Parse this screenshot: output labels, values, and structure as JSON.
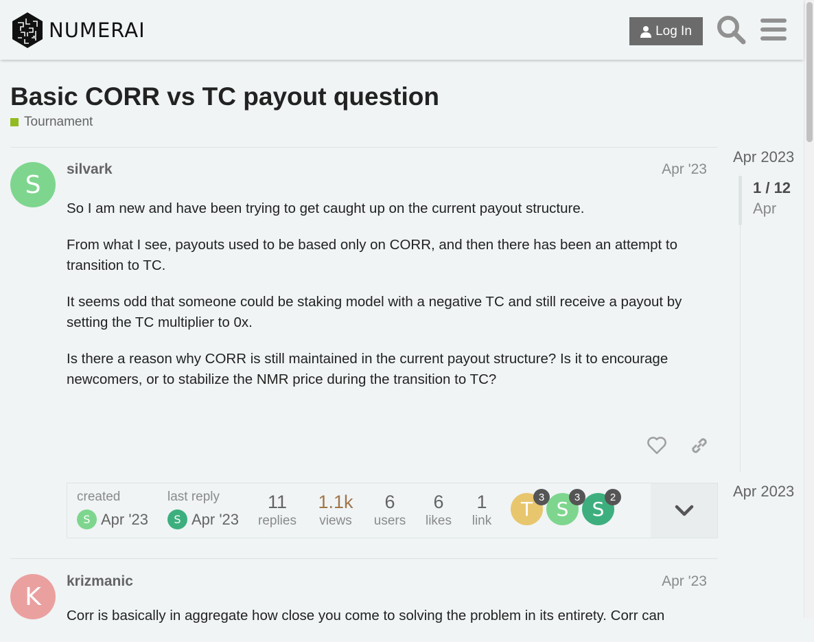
{
  "header": {
    "logo_text": "NUMERAI",
    "login_label": "Log In"
  },
  "topic": {
    "title": "Basic CORR vs TC payout question",
    "category": "Tournament",
    "category_color": "#92ba21"
  },
  "posts": [
    {
      "username": "silvark",
      "avatar_letter": "S",
      "avatar_color": "#7ed68e",
      "date": "Apr '23",
      "paragraphs": [
        "So I am new and have been trying to get caught up on the current payout structure.",
        "From what I see, payouts used to be based only on CORR, and then there has been an attempt to transition to TC.",
        "It seems odd that someone could be staking model with a negative TC and still receive a payout by setting the TC multiplier to 0x.",
        "Is there a reason why CORR is still maintained in the current payout structure? Is it to encourage newcomers, or to stabilize the NMR price during the transition to TC?"
      ]
    },
    {
      "username": "krizmanic",
      "avatar_letter": "K",
      "avatar_color": "#eba0a0",
      "date": "Apr '23",
      "paragraphs": [
        "Corr is basically in aggregate how close you come to solving the problem in its entirety. Corr can"
      ]
    }
  ],
  "topic_map": {
    "created_label": "created",
    "created_date": "Apr '23",
    "last_reply_label": "last reply",
    "last_reply_date": "Apr '23",
    "stats": [
      {
        "value": "11",
        "label": "replies"
      },
      {
        "value": "1.1k",
        "label": "views"
      },
      {
        "value": "6",
        "label": "users"
      },
      {
        "value": "6",
        "label": "likes"
      },
      {
        "value": "1",
        "label": "link"
      }
    ],
    "participants": [
      {
        "letter": "T",
        "color": "#e8c66e",
        "count": "3"
      },
      {
        "letter": "S",
        "color": "#7ed68e",
        "count": "3"
      },
      {
        "letter": "S",
        "color": "#3daf7e",
        "count": "2"
      }
    ]
  },
  "timeline": {
    "start_label": "Apr 2023",
    "position": "1 / 12",
    "position_date": "Apr",
    "end_label": "Apr 2023"
  },
  "icons": [
    "search-icon",
    "menu-icon",
    "user-icon",
    "heart-icon",
    "link-icon",
    "chevron-down-icon"
  ]
}
